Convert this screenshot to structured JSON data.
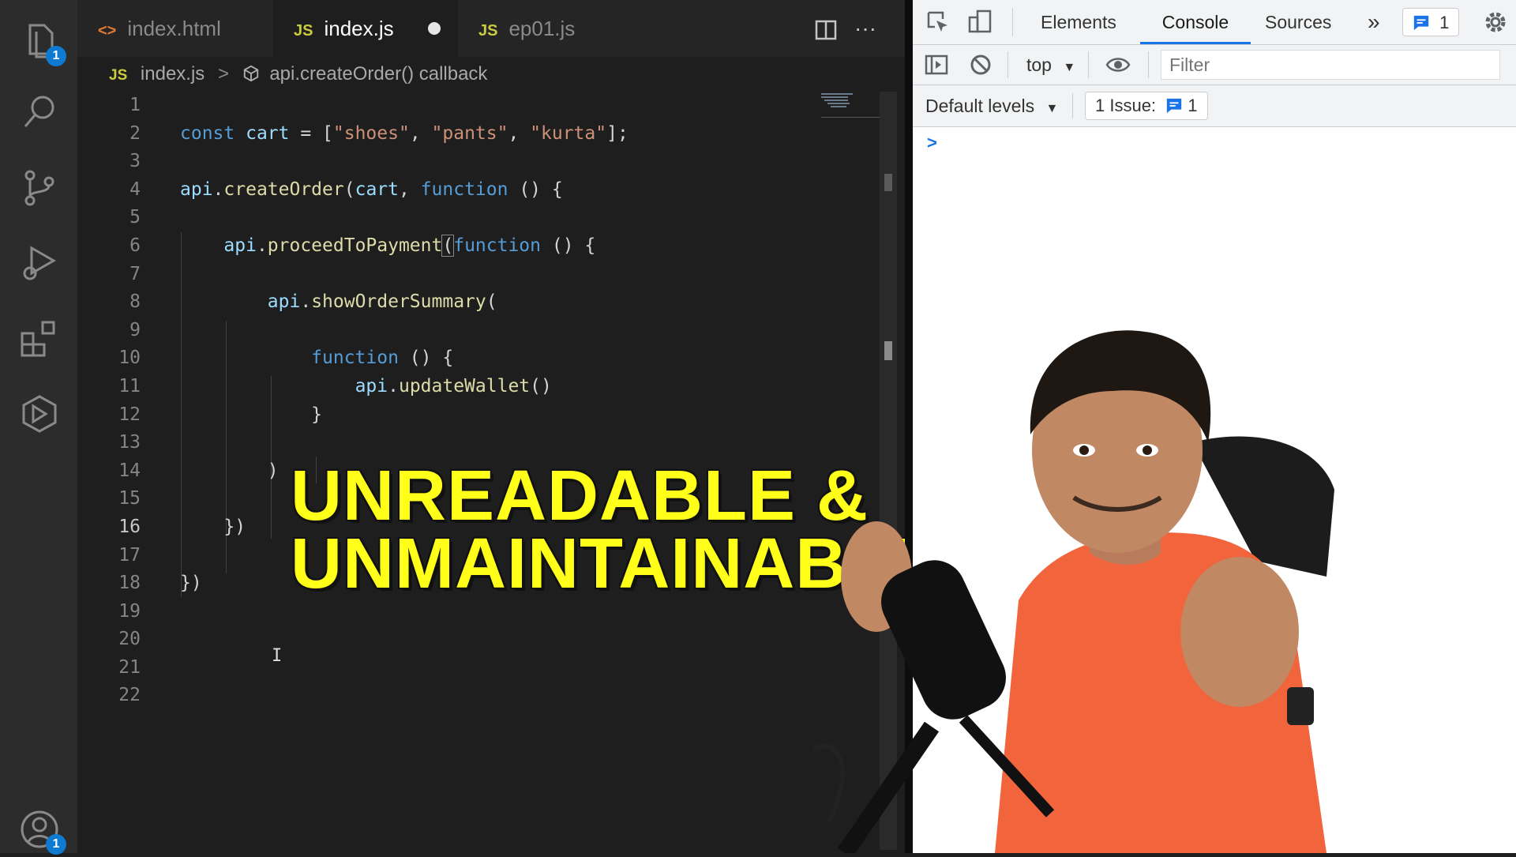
{
  "activity_bar": {
    "explorer_badge": "1",
    "accounts_badge": "1"
  },
  "tabs": [
    {
      "label": "index.html",
      "icon": "<>"
    },
    {
      "label": "index.js",
      "icon": "JS"
    },
    {
      "label": "ep01.js",
      "icon": "JS"
    }
  ],
  "tab_actions": {
    "split": "split-editor-icon",
    "more": "···"
  },
  "breadcrumb": {
    "file_icon": "JS",
    "file": "index.js",
    "separator": ">",
    "symbol": "api.createOrder() callback"
  },
  "editor": {
    "current_line": 16,
    "line_numbers": [
      "1",
      "2",
      "3",
      "4",
      "5",
      "6",
      "7",
      "8",
      "9",
      "10",
      "11",
      "12",
      "13",
      "14",
      "15",
      "16",
      "17",
      "18",
      "19",
      "20",
      "21",
      "22"
    ]
  },
  "overlay": {
    "line1": "UNREADABLE &",
    "line2": "UNMAINTAINABLE"
  },
  "devtools": {
    "tabs": [
      "Elements",
      "Console",
      "Sources"
    ],
    "active_tab": "Console",
    "more_tabs": "»",
    "issues_count": "1",
    "context": "top",
    "filter_placeholder": "Filter",
    "levels": "Default levels",
    "issue_chip_label": "1 Issue:",
    "issue_chip_count": "1",
    "prompt": ">"
  },
  "colors": {
    "overlay_text": "#ffff1a",
    "keyword": "#569cd6",
    "string": "#ce9178",
    "function": "#dcdcaa",
    "variable": "#9cdcfe",
    "devtools_accent": "#1a73e8"
  }
}
